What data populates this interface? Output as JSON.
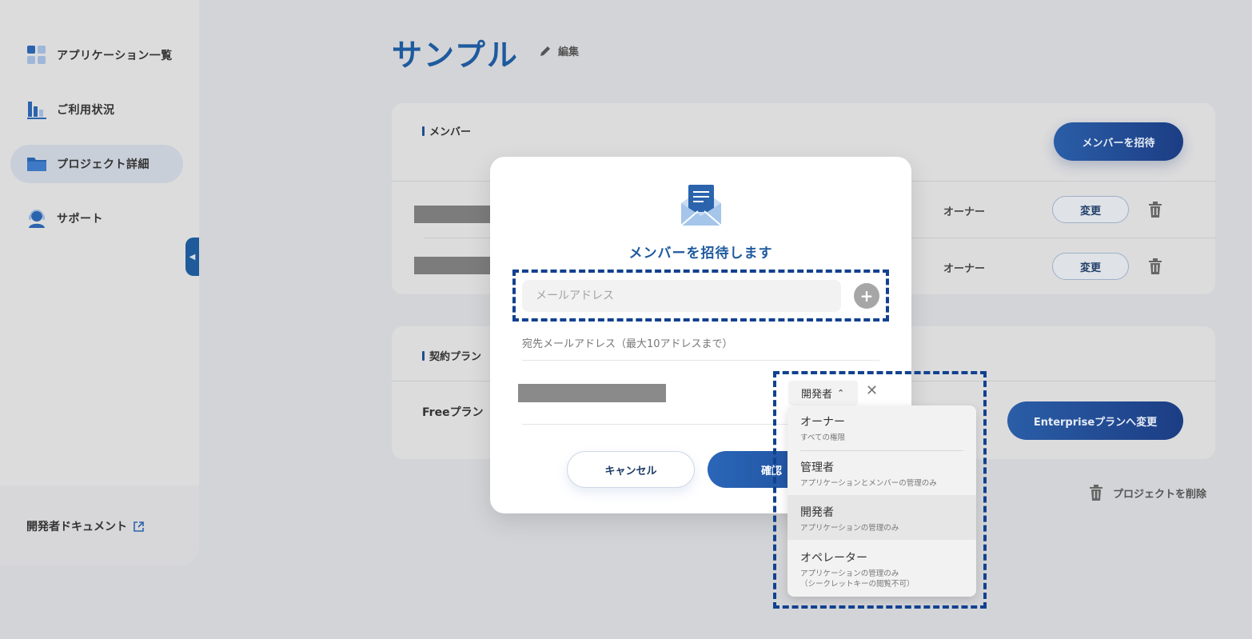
{
  "sidebar": {
    "items": [
      {
        "label": "アプリケーション一覧",
        "icon": "grid-icon"
      },
      {
        "label": "ご利用状況",
        "icon": "bar-chart-icon"
      },
      {
        "label": "プロジェクト詳細",
        "icon": "folder-icon"
      },
      {
        "label": "サポート",
        "icon": "headset-icon"
      }
    ],
    "developer_docs": "開発者ドキュメント"
  },
  "header": {
    "title": "サンプル",
    "edit_label": "編集"
  },
  "members": {
    "section_title": "メンバー",
    "invite_button": "メンバーを招待",
    "rows": [
      {
        "role": "オーナー",
        "change_label": "変更"
      },
      {
        "role": "オーナー",
        "change_label": "変更"
      }
    ]
  },
  "plan": {
    "section_title": "契約プラン",
    "current_plan": "Freeプラン",
    "upgrade_button": "Enterpriseプランへ変更"
  },
  "delete_project": "プロジェクトを削除",
  "modal": {
    "title": "メンバーを招待します",
    "email_placeholder": "メールアドレス",
    "helper_text": "宛先メールアドレス（最大10アドレスまで）",
    "selected_role": "開発者",
    "cancel_button": "キャンセル",
    "confirm_button": "確認"
  },
  "role_dropdown": {
    "options": [
      {
        "title": "オーナー",
        "desc": "すべての権限"
      },
      {
        "title": "管理者",
        "desc": "アプリケーションとメンバーの管理のみ"
      },
      {
        "title": "開発者",
        "desc": "アプリケーションの管理のみ",
        "selected": true
      },
      {
        "title": "オペレーター",
        "desc": "アプリケーションの管理のみ",
        "desc2": "（シークレットキーの閲覧不可）"
      }
    ]
  },
  "colors": {
    "accent": "#1e5a9e",
    "highlight_border": "#12418f"
  }
}
